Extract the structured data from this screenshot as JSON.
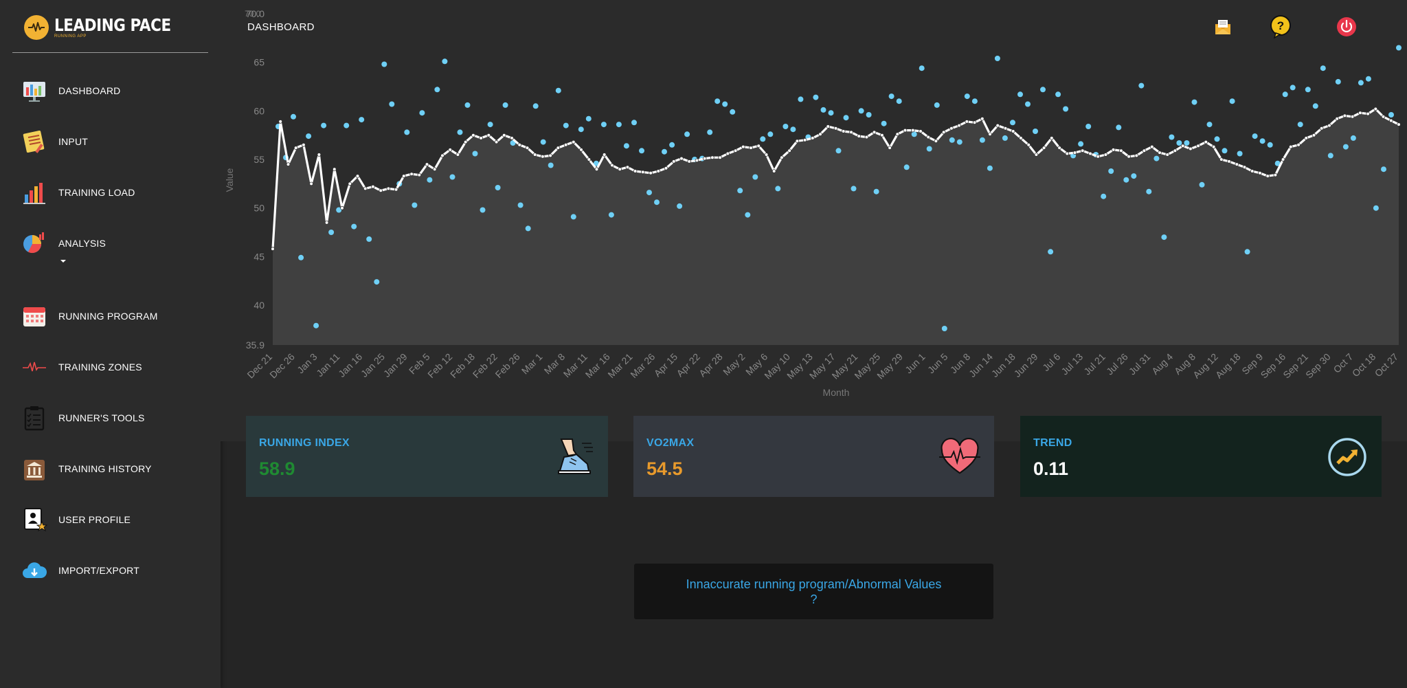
{
  "brand": {
    "name": "LEADING PACE",
    "sub": "RUNNING APP"
  },
  "nav": {
    "items": [
      {
        "label": "DASHBOARD",
        "icon": "dashboard-icon"
      },
      {
        "label": "INPUT",
        "icon": "notepad-icon"
      },
      {
        "label": "TRAINING LOAD",
        "icon": "bar-chart-icon"
      },
      {
        "label": "ANALYSIS",
        "icon": "pie-chart-icon"
      },
      {
        "label": "RUNNING PROGRAM",
        "icon": "calendar-icon"
      },
      {
        "label": "TRAINING ZONES",
        "icon": "heartbeat-line-icon"
      },
      {
        "label": "RUNNER'S TOOLS",
        "icon": "clipboard-icon"
      },
      {
        "label": "TRAINING HISTORY",
        "icon": "museum-icon"
      },
      {
        "label": "USER PROFILE",
        "icon": "user-profile-icon"
      },
      {
        "label": "IMPORT/EXPORT",
        "icon": "cloud-upload-icon"
      }
    ]
  },
  "header": {
    "title": "DASHBOARD",
    "ghost_label": "70.0",
    "icons": [
      "mail-icon",
      "help-icon",
      "power-icon"
    ]
  },
  "chart_data": {
    "type": "line",
    "xlabel": "Month",
    "ylabel": "Value",
    "ylim": [
      35.9,
      70.0
    ],
    "yticks": [
      "70.0",
      "65",
      "60",
      "55",
      "50",
      "45",
      "40",
      "35.9"
    ],
    "x_tick_labels": [
      "Dec 21",
      "Dec 26",
      "Jan 3",
      "Jan 11",
      "Jan 16",
      "Jan 25",
      "Jan 29",
      "Feb 5",
      "Feb 12",
      "Feb 18",
      "Feb 22",
      "Feb 26",
      "Mar 1",
      "Mar 8",
      "Mar 11",
      "Mar 16",
      "Mar 21",
      "Mar 26",
      "Apr 15",
      "Apr 22",
      "Apr 28",
      "May 2",
      "May 6",
      "May 10",
      "May 13",
      "May 17",
      "May 21",
      "May 25",
      "May 29",
      "Jun 1",
      "Jun 5",
      "Jun 8",
      "Jun 14",
      "Jun 18",
      "Jun 29",
      "Jul 6",
      "Jul 13",
      "Jul 21",
      "Jul 26",
      "Jul 31",
      "Aug 4",
      "Aug 8",
      "Aug 12",
      "Aug 18",
      "Sep 9",
      "Sep 16",
      "Sep 21",
      "Sep 30",
      "Oct 7",
      "Oct 18",
      "Oct 27"
    ],
    "series": [
      {
        "name": "",
        "kind": "line",
        "color": "#ffffff",
        "values": [
          45.8,
          58.9,
          54.5,
          56.2,
          56.5,
          52.5,
          55.5,
          48.5,
          54,
          50,
          52.5,
          53.3,
          52,
          52.2,
          51.8,
          52,
          51.9,
          53.3,
          53.5,
          53.4,
          54.5,
          54,
          55.4,
          56,
          55.5,
          56.8,
          57.5,
          57.2,
          57.5,
          56.8,
          57.5,
          57.2,
          56.5,
          56.2,
          55.5,
          55.3,
          55.4,
          56.2,
          56.5,
          56.8,
          56,
          55,
          54,
          55.5,
          54.4,
          54,
          54.2,
          53.8,
          53.7,
          53.6,
          53.8,
          54.1,
          54.8,
          55.1,
          54.8,
          54.9,
          55.1,
          55.2,
          55.2,
          55.6,
          55.9,
          56.3,
          56.2,
          56.4,
          55.5,
          53.8,
          55.2,
          55.9,
          56.9,
          57,
          57.2,
          57.6,
          58.4,
          58.2,
          57.9,
          57.8,
          57.4,
          57.3,
          57.8,
          57.5,
          56.2,
          57.6,
          58,
          58,
          57.9,
          57.3,
          56.9,
          57.8,
          58.2,
          58.5,
          58.9,
          58.8,
          59.2,
          57.6,
          58.5,
          58.2,
          57.9,
          57.2,
          56.5,
          55.5,
          56.2,
          57.2,
          56.2,
          55.6,
          55.7,
          55.9,
          55.6,
          55.3,
          55.5,
          56,
          55.9,
          55.3,
          55.4,
          55.9,
          56.3,
          55.7,
          55.5,
          55.9,
          56.4,
          56.1,
          56.4,
          56.8,
          56.3,
          55,
          54.8,
          54.5,
          54.2,
          53.8,
          53.6,
          53.3,
          53.4,
          55,
          56.3,
          56.5,
          57.2,
          57.5,
          58.2,
          58.5,
          59.2,
          59.5,
          59.4,
          59.8,
          59.7,
          60.2,
          59.4,
          59,
          58.6
        ]
      },
      {
        "name": "",
        "kind": "scatter",
        "color": "#6fd0f6",
        "values": [
          58.4,
          55.2,
          59.4,
          44.9,
          57.4,
          37.9,
          58.5,
          47.5,
          49.8,
          58.5,
          48.1,
          59.1,
          46.8,
          42.4,
          64.8,
          60.7,
          52.5,
          57.8,
          50.3,
          59.8,
          52.9,
          62.2,
          65.1,
          53.2,
          57.8,
          60.6,
          55.6,
          49.8,
          58.6,
          52.1,
          60.6,
          56.7,
          50.3,
          47.9,
          60.5,
          56.8,
          54.4,
          62.1,
          58.5,
          49.1,
          58.1,
          59.2,
          54.6,
          58.6,
          49.3,
          58.6,
          56.4,
          58.8,
          55.9,
          51.6,
          50.6,
          55.8,
          56.5,
          50.2,
          57.6,
          55,
          55.1,
          57.8,
          61,
          60.7,
          59.9,
          51.8,
          49.3,
          53.2,
          57.1,
          57.6,
          52,
          58.4,
          58.1,
          61.2,
          57.3,
          61.4,
          60.1,
          59.8,
          55.9,
          59.3,
          52,
          60,
          59.6,
          51.7,
          58.7,
          61.5,
          61,
          54.2,
          57.6,
          64.4,
          56.1,
          60.6,
          37.6,
          57,
          56.8,
          61.5,
          61,
          57,
          54.1,
          65.4,
          57.2,
          58.8,
          61.7,
          60.7,
          57.9,
          62.2,
          45.5,
          61.7,
          60.2,
          55.4,
          56.6,
          58.4,
          55.5,
          51.2,
          53.8,
          58.3,
          52.9,
          53.3,
          62.6,
          51.7,
          55.1,
          47,
          57.3,
          56.7,
          56.7,
          60.9,
          52.4,
          58.6,
          57.1,
          55.9,
          61,
          55.6,
          45.5,
          57.4,
          56.9,
          56.5,
          54.6,
          61.7,
          62.4,
          58.6,
          62.2,
          60.5,
          64.4,
          55.4,
          63,
          56.3,
          57.2,
          62.9,
          63.3,
          50,
          54,
          59.6,
          66.5
        ]
      }
    ]
  },
  "cards": [
    {
      "title": "RUNNING INDEX",
      "value": "58.9",
      "value_color": "#1f8a32",
      "bg": "#29393b",
      "icon": "running-shoe-icon"
    },
    {
      "title": "VO2MAX",
      "value": "54.5",
      "value_color": "#e89a2c",
      "bg": "#34383f",
      "icon": "heart-rate-icon"
    },
    {
      "title": "TREND",
      "value": "0.11",
      "value_color": "#ffffff",
      "bg": "#13231e",
      "icon": "trend-up-icon"
    }
  ],
  "help": {
    "text": "Innaccurate running program/Abnormal Values ?"
  }
}
